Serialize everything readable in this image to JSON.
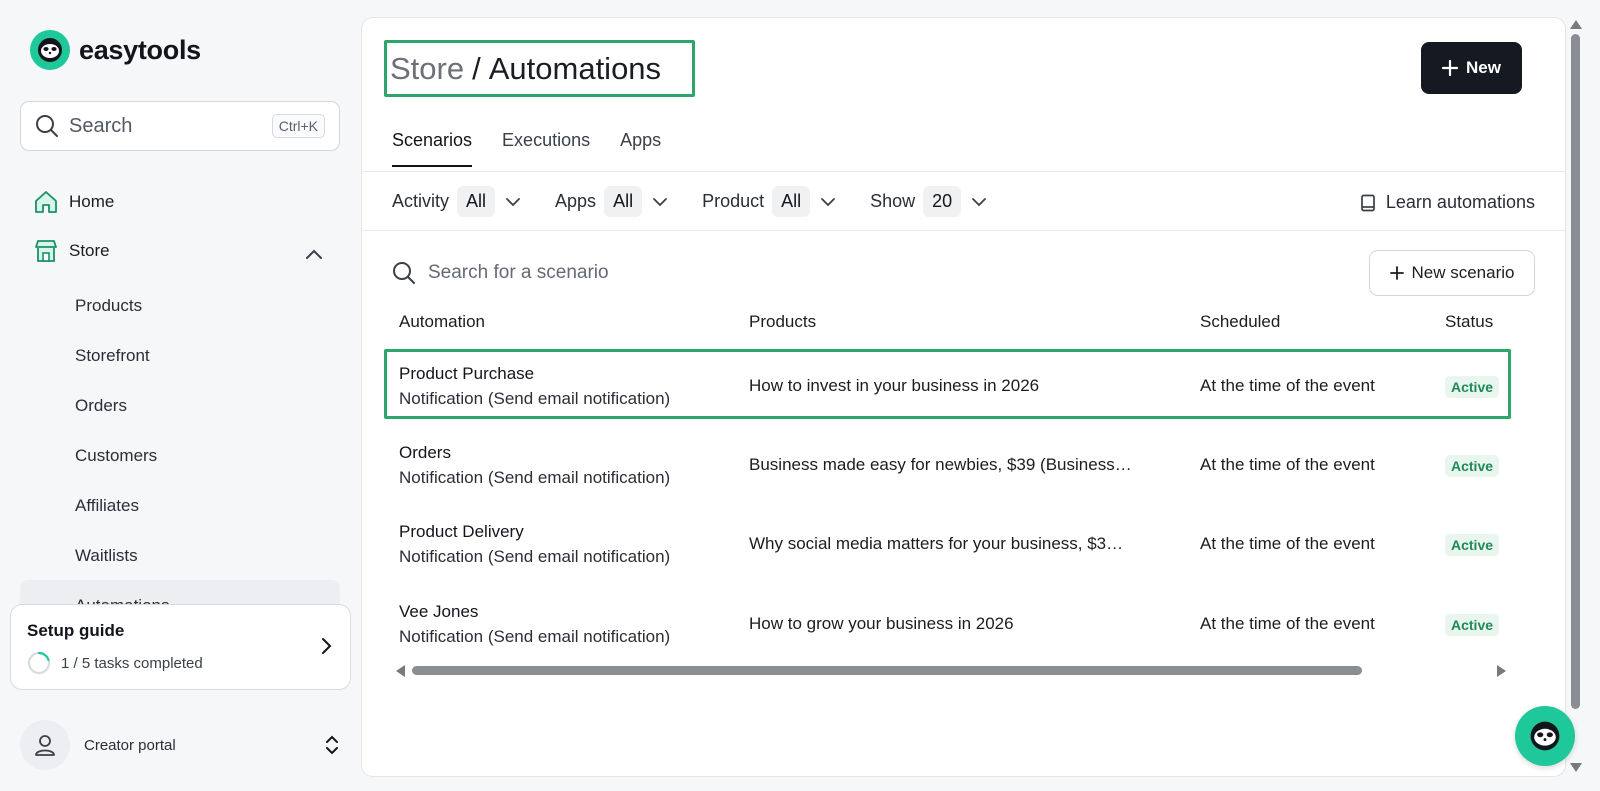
{
  "brand": {
    "name": "easytools",
    "accent": "#1fc89a"
  },
  "sidebar": {
    "search_placeholder": "Search",
    "search_shortcut": "Ctrl+K",
    "nav": [
      {
        "label": "Home",
        "icon": "home-icon"
      },
      {
        "label": "Store",
        "icon": "store-icon",
        "expanded": true
      }
    ],
    "store_items": [
      "Products",
      "Storefront",
      "Orders",
      "Customers",
      "Affiliates",
      "Waitlists",
      "Automations"
    ],
    "setup_guide": {
      "title": "Setup guide",
      "progress_text": "1 / 5 tasks completed",
      "completed": 1,
      "total": 5
    },
    "creator_portal": "Creator portal"
  },
  "header": {
    "breadcrumb_parent": "Store",
    "breadcrumb_separator": "/",
    "breadcrumb_current": "Automations",
    "new_button": "New"
  },
  "tabs": [
    "Scenarios",
    "Executions",
    "Apps"
  ],
  "filters": [
    {
      "label": "Activity",
      "value": "All"
    },
    {
      "label": "Apps",
      "value": "All"
    },
    {
      "label": "Product",
      "value": "All"
    },
    {
      "label": "Show",
      "value": "20"
    }
  ],
  "learn_link": "Learn automations",
  "scenario_search_placeholder": "Search for a scenario",
  "new_scenario_button": "New scenario",
  "table": {
    "columns": [
      "Automation",
      "Products",
      "Scheduled",
      "Status"
    ],
    "rows": [
      {
        "title": "Product Purchase",
        "subtitle": "Notification (Send email notification)",
        "product": "How to invest in your business in 2026",
        "scheduled": "At the time of the event",
        "status": "Active",
        "highlighted": true
      },
      {
        "title": "Orders",
        "subtitle": "Notification (Send email notification)",
        "product": "Business made easy for newbies, $39 (Business…",
        "scheduled": "At the time of the event",
        "status": "Active"
      },
      {
        "title": "Product Delivery",
        "subtitle": "Notification (Send email notification)",
        "product": "Why social media matters for your business, $3…",
        "scheduled": "At the time of the event",
        "status": "Active"
      },
      {
        "title": "Vee Jones",
        "subtitle": "Notification (Send email notification)",
        "product": "How to grow your business in 2026",
        "scheduled": "At the time of the event",
        "status": "Active"
      }
    ]
  }
}
